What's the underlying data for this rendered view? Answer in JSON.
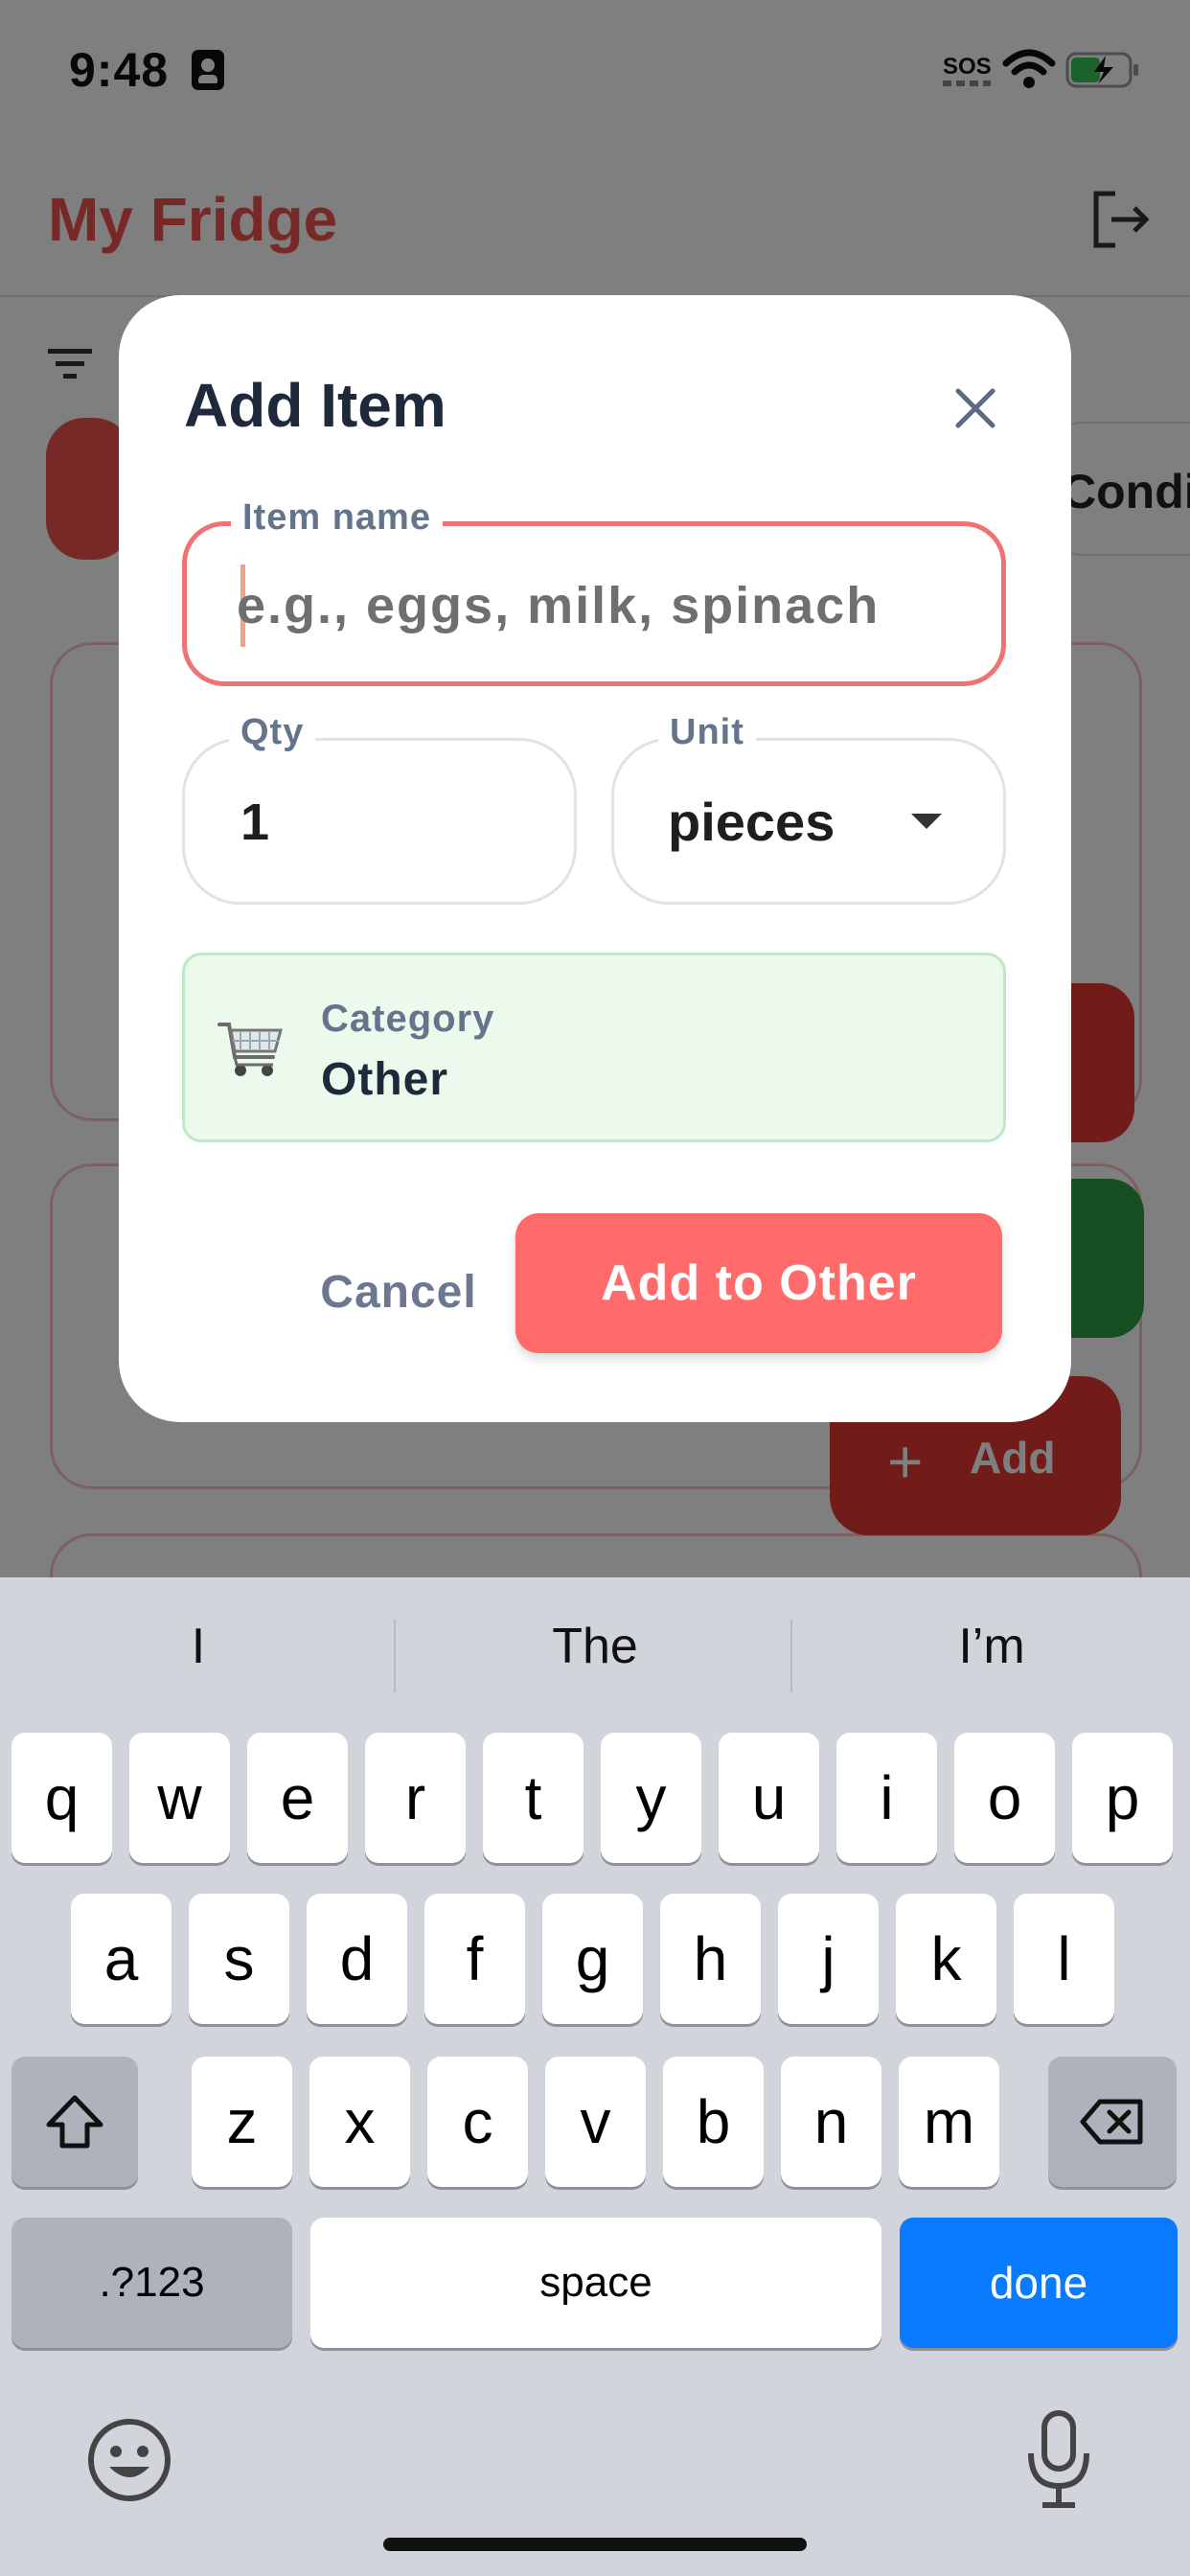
{
  "status_bar": {
    "time": "9:48",
    "sos": "SOS"
  },
  "app": {
    "title": "My Fridge",
    "partial_chip_label": "Condi",
    "fab_add_label": "Add",
    "fab_add_symbol": "+"
  },
  "dialog": {
    "title": "Add Item",
    "close_symbol": "×",
    "item_name": {
      "label": "Item name",
      "value": "",
      "placeholder": "e.g., eggs, milk, spinach"
    },
    "qty": {
      "label": "Qty",
      "value": "1"
    },
    "unit": {
      "label": "Unit",
      "value": "pieces"
    },
    "category": {
      "label": "Category",
      "value": "Other"
    },
    "cancel_label": "Cancel",
    "submit_label": "Add to Other"
  },
  "keyboard": {
    "suggestions": [
      "I",
      "The",
      "I’m"
    ],
    "row1": [
      "q",
      "w",
      "e",
      "r",
      "t",
      "y",
      "u",
      "i",
      "o",
      "p"
    ],
    "row2": [
      "a",
      "s",
      "d",
      "f",
      "g",
      "h",
      "j",
      "k",
      "l"
    ],
    "row3": [
      "z",
      "x",
      "c",
      "v",
      "b",
      "n",
      "m"
    ],
    "numbers_label": ".?123",
    "space_label": "space",
    "done_label": "done"
  },
  "colors": {
    "accent": "#ff6b6b",
    "title_red": "#ef5350",
    "category_bg": "#ecfaee",
    "keyboard_done": "#0a7aff"
  },
  "icons": [
    "filter-icon",
    "logout-icon",
    "close-icon",
    "cart-icon",
    "shift-icon",
    "backspace-icon",
    "emoji-icon",
    "mic-icon",
    "wifi-icon",
    "battery-icon"
  ]
}
